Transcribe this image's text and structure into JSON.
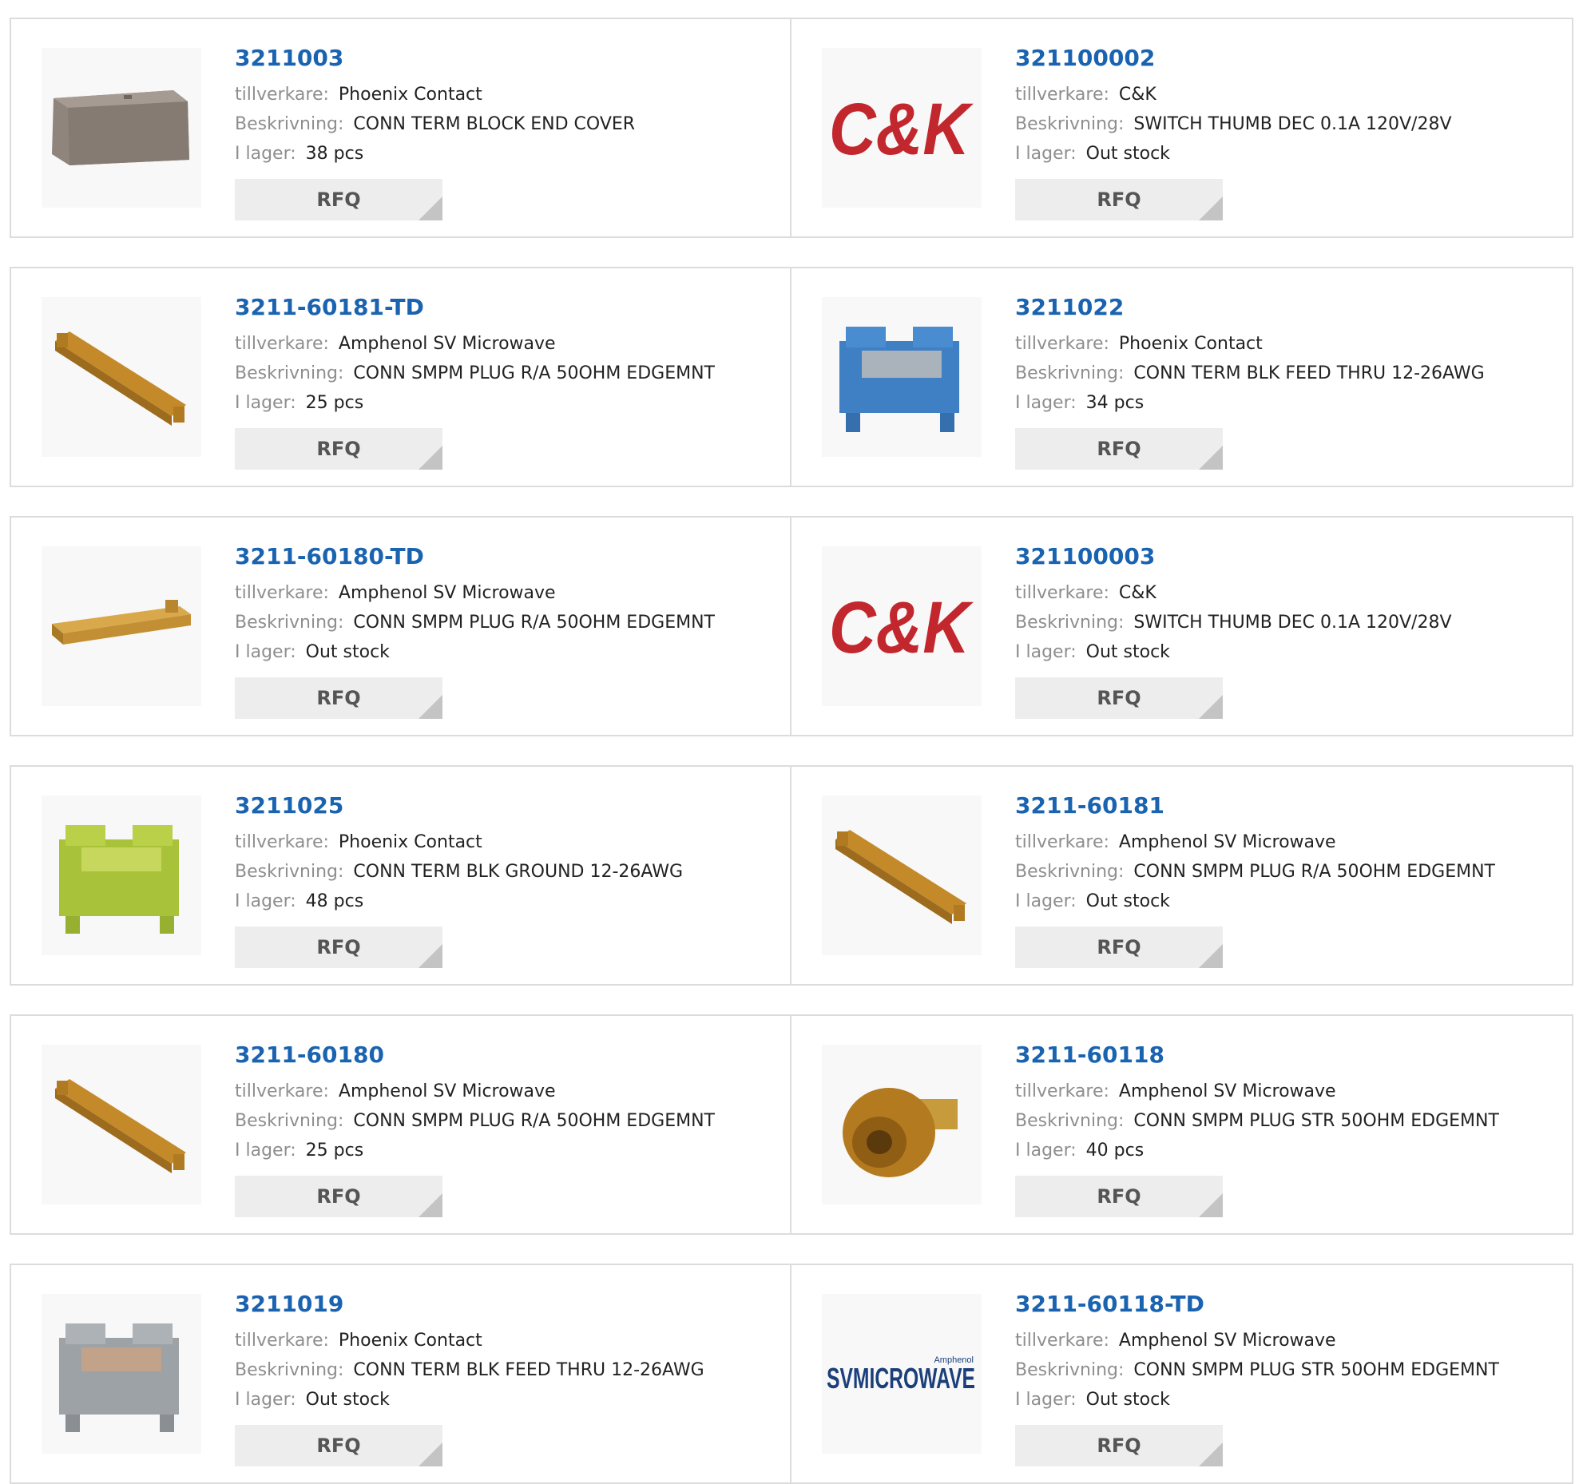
{
  "labels": {
    "manufacturer": "tillverkare:",
    "description": "Beskrivning:",
    "stock": "I lager:",
    "rfq": "RFQ"
  },
  "colors": {
    "part_link": "#1a63b0",
    "label_gray": "#8e8e8e",
    "card_border": "#dcdcdc",
    "rfq_bg": "#ededed"
  },
  "products": [
    {
      "part": "3211003",
      "manufacturer": "Phoenix Contact",
      "description": "CONN TERM BLOCK END COVER",
      "stock": "38 pcs",
      "image": "end-cover-gray"
    },
    {
      "part": "321100002",
      "manufacturer": "C&K",
      "description": "SWITCH THUMB DEC 0.1A 120V/28V",
      "stock": "Out stock",
      "image": "ck-logo",
      "logo_text": "C&K"
    },
    {
      "part": "3211-60181-TD",
      "manufacturer": "Amphenol SV Microwave",
      "description": "CONN SMPM PLUG R/A 50OHM EDGEMNT",
      "stock": "25 pcs",
      "image": "connector-bar-diagonal"
    },
    {
      "part": "3211022",
      "manufacturer": "Phoenix Contact",
      "description": "CONN TERM BLK FEED THRU 12-26AWG",
      "stock": "34 pcs",
      "image": "terminal-block-blue"
    },
    {
      "part": "3211-60180-TD",
      "manufacturer": "Amphenol SV Microwave",
      "description": "CONN SMPM PLUG R/A 50OHM EDGEMNT",
      "stock": "Out stock",
      "image": "connector-bar-flat"
    },
    {
      "part": "321100003",
      "manufacturer": "C&K",
      "description": "SWITCH THUMB DEC 0.1A 120V/28V",
      "stock": "Out stock",
      "image": "ck-logo",
      "logo_text": "C&K"
    },
    {
      "part": "3211025",
      "manufacturer": "Phoenix Contact",
      "description": "CONN TERM BLK GROUND 12-26AWG",
      "stock": "48 pcs",
      "image": "terminal-block-green"
    },
    {
      "part": "3211-60181",
      "manufacturer": "Amphenol SV Microwave",
      "description": "CONN SMPM PLUG R/A 50OHM EDGEMNT",
      "stock": "Out stock",
      "image": "connector-bar-diagonal"
    },
    {
      "part": "3211-60180",
      "manufacturer": "Amphenol SV Microwave",
      "description": "CONN SMPM PLUG R/A 50OHM EDGEMNT",
      "stock": "25 pcs",
      "image": "connector-bar-diagonal"
    },
    {
      "part": "3211-60118",
      "manufacturer": "Amphenol SV Microwave",
      "description": "CONN SMPM PLUG STR 50OHM EDGEMNT",
      "stock": "40 pcs",
      "image": "smpm-plug-gold"
    },
    {
      "part": "3211019",
      "manufacturer": "Phoenix Contact",
      "description": "CONN TERM BLK FEED THRU 12-26AWG",
      "stock": "Out stock",
      "image": "terminal-block-gray"
    },
    {
      "part": "3211-60118-TD",
      "manufacturer": "Amphenol SV Microwave",
      "description": "CONN SMPM PLUG STR 50OHM EDGEMNT",
      "stock": "Out stock",
      "image": "sv-microwave-logo",
      "logo_text": "SVMICROWAVE",
      "logo_small": "Amphenol"
    }
  ]
}
